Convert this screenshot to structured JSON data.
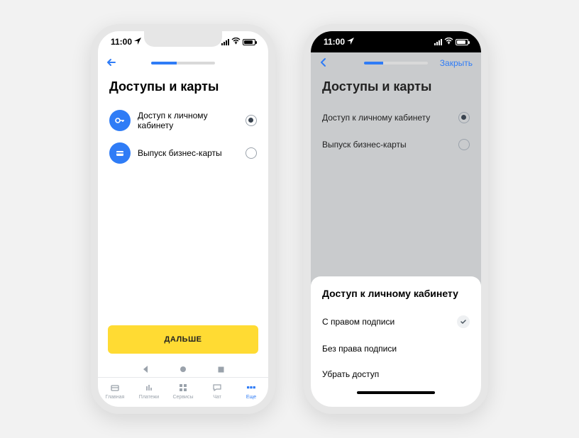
{
  "status": {
    "time": "11:00"
  },
  "progress": {
    "left_pct": 40,
    "right_pct": 30
  },
  "close_label": "Закрыть",
  "title": "Доступы и карты",
  "options": [
    {
      "label": "Доступ к личному кабинету",
      "selected": true
    },
    {
      "label": "Выпуск бизнес-карты",
      "selected": false
    }
  ],
  "primary_button": "ДАЛЬШЕ",
  "tabs": [
    {
      "label": "Главная"
    },
    {
      "label": "Платежи"
    },
    {
      "label": "Сервисы"
    },
    {
      "label": "Чат"
    },
    {
      "label": "Еще",
      "active": true
    }
  ],
  "sheet": {
    "title": "Доступ к личному кабинету",
    "items": [
      {
        "label": "С правом подписи",
        "checked": true
      },
      {
        "label": "Без права подписи",
        "checked": false
      },
      {
        "label": "Убрать доступ",
        "checked": false
      }
    ]
  }
}
